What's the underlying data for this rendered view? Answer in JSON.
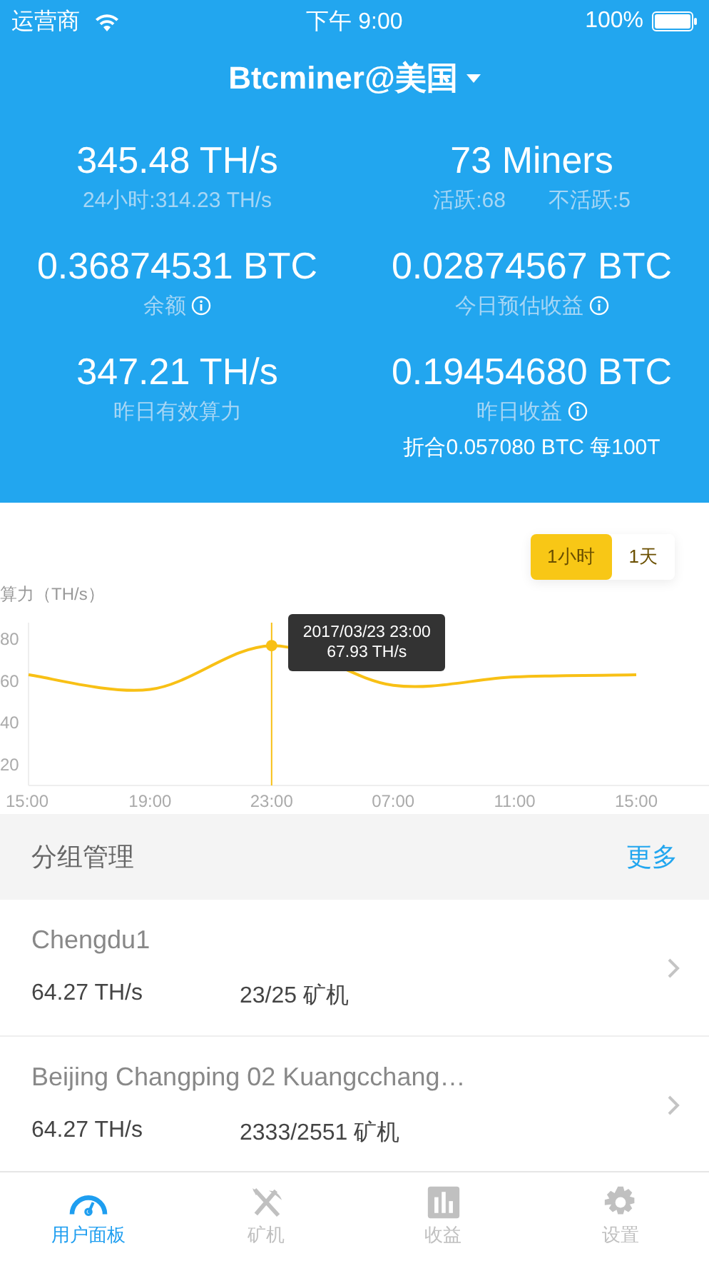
{
  "status_bar": {
    "carrier": "运营商",
    "time": "下午 9:00",
    "battery": "100%"
  },
  "header": {
    "title": "Btcminer@美国"
  },
  "stats": [
    {
      "value": "345.48 TH/s",
      "labels": [
        "24小时:314.23 TH/s"
      ],
      "info": false
    },
    {
      "value": "73 Miners",
      "labels": [
        "活跃:68",
        "不活跃:5"
      ],
      "info": false
    },
    {
      "value": "0.36874531 BTC",
      "labels": [
        "余额"
      ],
      "info": true
    },
    {
      "value": "0.02874567 BTC",
      "labels": [
        "今日预估收益"
      ],
      "info": true
    },
    {
      "value": "347.21 TH/s",
      "labels": [
        "昨日有效算力"
      ],
      "info": false
    },
    {
      "value": "0.19454680 BTC",
      "labels": [
        "昨日收益"
      ],
      "info": true,
      "note": "折合0.057080 BTC 每100T"
    }
  ],
  "chart": {
    "range_tabs": [
      {
        "label": "1小时",
        "selected": true
      },
      {
        "label": "1天",
        "selected": false
      }
    ],
    "chart_data": {
      "type": "line",
      "ylabel": "算力（TH/s）",
      "categories": [
        "15:00",
        "19:00",
        "23:00",
        "07:00",
        "11:00",
        "15:00"
      ],
      "series": [
        {
          "color": "#f8c015",
          "values": [
            63,
            56,
            77,
            58,
            62,
            63
          ]
        }
      ],
      "ylim": [
        10,
        88
      ],
      "yticks": [
        20,
        40,
        60,
        80
      ],
      "annotations": [
        {
          "x": "23:00",
          "y": 77,
          "text": "2017/03/23 23:00\n67.93 TH/s"
        }
      ],
      "ref_lines": [
        {
          "axis": "x",
          "value": "23:00",
          "color": "#f8c015"
        }
      ]
    }
  },
  "groups": {
    "title": "分组管理",
    "more": "更多",
    "items": [
      {
        "name": "Chengdu1",
        "hashrate": "64.27 TH/s",
        "miners": "23/25 矿机"
      },
      {
        "name": "Beijing Changping 02 Kuangcchang…",
        "hashrate": "64.27 TH/s",
        "miners": "2333/2551 矿机"
      }
    ]
  },
  "tabbar": [
    {
      "label": "用户面板",
      "selected": true
    },
    {
      "label": "矿机",
      "selected": false
    },
    {
      "label": "收益",
      "selected": false
    },
    {
      "label": "设置",
      "selected": false
    }
  ]
}
